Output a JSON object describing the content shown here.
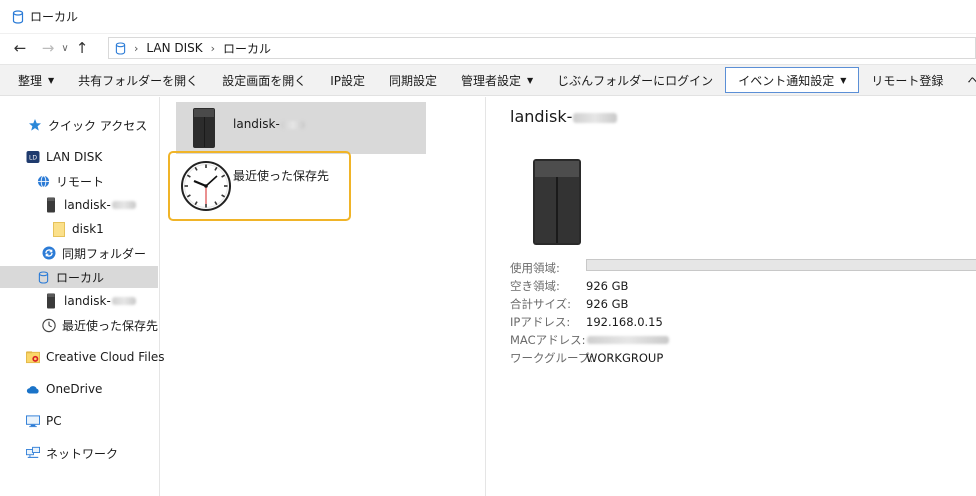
{
  "window": {
    "title": "ローカル"
  },
  "address": {
    "crumbs": [
      "LAN DISK",
      "ローカル"
    ]
  },
  "toolbar": {
    "items": [
      {
        "label": "整理",
        "has_caret": true
      },
      {
        "label": "共有フォルダーを開く"
      },
      {
        "label": "設定画面を開く"
      },
      {
        "label": "IP設定"
      },
      {
        "label": "同期設定"
      },
      {
        "label": "管理者設定",
        "has_caret": true
      },
      {
        "label": "じぶんフォルダーにログイン"
      },
      {
        "label": "イベント通知設定",
        "has_caret": true,
        "active": true
      },
      {
        "label": "リモート登録"
      },
      {
        "label": "ヘルプ"
      }
    ]
  },
  "nav": {
    "quick_access": "クイック アクセス",
    "lan_disk": "LAN DISK",
    "remote": "リモート",
    "remote_device": "landisk-",
    "disk1": "disk1",
    "sync_folder": "同期フォルダー",
    "local": "ローカル",
    "local_device": "landisk-",
    "recent": "最近使った保存先",
    "creative_cloud": "Creative Cloud Files",
    "onedrive": "OneDrive",
    "pc": "PC",
    "network": "ネットワーク"
  },
  "content": {
    "tile_device": "landisk-",
    "tile_recent": "最近使った保存先"
  },
  "details": {
    "title": "landisk-",
    "usage_label": "使用領域:",
    "usage_fraction": 0.0,
    "free_label": "空き領域:",
    "free_value": "926 GB",
    "total_label": "合計サイズ:",
    "total_value": "926 GB",
    "ip_label": "IPアドレス:",
    "ip_value": "192.168.0.15",
    "mac_label": "MACアドレス:",
    "workgroup_label": "ワークグループ:",
    "workgroup_value": "WORKGROUP"
  },
  "colors": {
    "selection": "#d9d9d9",
    "highlight_border": "#f0b428",
    "active_button_border": "#5b8fd6"
  }
}
